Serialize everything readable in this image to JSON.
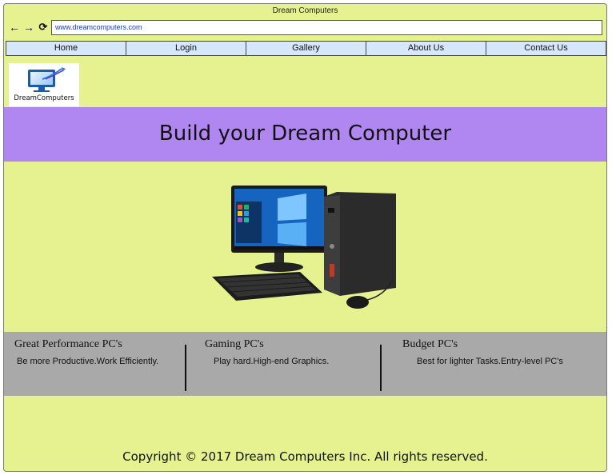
{
  "window": {
    "title": "Dream Computers"
  },
  "browser": {
    "url": "www.dreamcomputers.com",
    "back_icon": "arrow-left",
    "forward_icon": "arrow-right",
    "reload_icon": "reload"
  },
  "nav": {
    "tabs": [
      {
        "label": "Home"
      },
      {
        "label": "Login"
      },
      {
        "label": "Gallery"
      },
      {
        "label": "About Us"
      },
      {
        "label": "Contact Us"
      }
    ]
  },
  "logo": {
    "text": "DreamComputers"
  },
  "hero": {
    "title": "Build your Dream Computer"
  },
  "features": [
    {
      "title": "Great Performance PC's",
      "desc": "Be more Productive.Work Efficiently."
    },
    {
      "title": "Gaming PC's",
      "desc": "Play hard.High-end Graphics."
    },
    {
      "title": "Budget PC's",
      "desc": "Best for lighter Tasks.Entry-level PC's"
    }
  ],
  "footer": {
    "text": "Copyright © 2017 Dream Computers Inc. All rights reserved."
  },
  "colors": {
    "page_bg": "#e6f28f",
    "hero_bg": "#b087f0",
    "tab_bg": "#d6e6fb",
    "features_bg": "#a9a9a9",
    "logo_blue": "#1f5aa6"
  }
}
